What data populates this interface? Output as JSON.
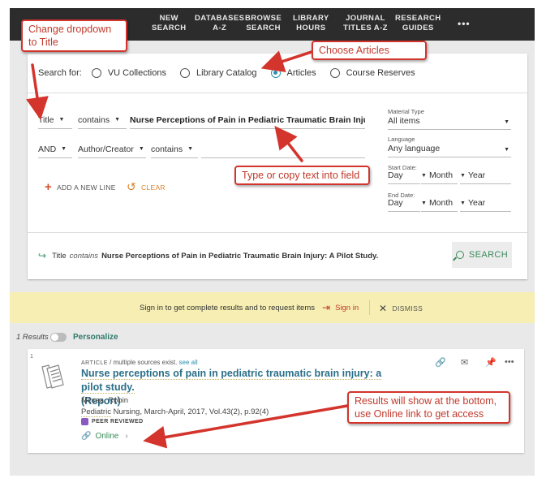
{
  "nav": {
    "items": [
      "NEW\nSEARCH",
      "DATABASES\nA-Z",
      "BROWSE\nSEARCH",
      "LIBRARY\nHOURS",
      "JOURNAL\nTITLES A-Z",
      "RESEARCH\nGUIDES"
    ],
    "more": "•••"
  },
  "search": {
    "scope_label": "Search for:",
    "scopes": [
      "VU Collections",
      "Library Catalog",
      "Articles",
      "Course Reserves"
    ],
    "selected_scope": "Articles",
    "row1": {
      "field": "Title",
      "operator": "contains",
      "query": "Nurse Perceptions of Pain in Pediatric Traumatic Brain Injury: A Pilot"
    },
    "row2": {
      "bool": "AND",
      "field": "Author/Creator",
      "operator": "contains",
      "query": ""
    },
    "material_type_label": "Material Type",
    "material_type_value": "All items",
    "language_label": "Language",
    "language_value": "Any language",
    "start_date_label": "Start Date:",
    "end_date_label": "End Date:",
    "date_day": "Day",
    "date_month": "Month",
    "date_year": "Year",
    "add_line": "ADD A NEW LINE",
    "clear": "CLEAR",
    "summary_field": "Title",
    "summary_op": "contains",
    "summary_query": "Nurse Perceptions of Pain in Pediatric Traumatic Brain Injury: A Pilot Study.",
    "button": "SEARCH"
  },
  "signin_bar": {
    "message": "Sign in to get complete results and to request items",
    "signin": "Sign in",
    "dismiss": "DISMISS"
  },
  "results": {
    "count": "1 Results",
    "personalize": "Personalize",
    "item": {
      "num": "1",
      "type": "ARTICLE",
      "type_note": "/ multiple sources exist.",
      "see_all": "see all",
      "title_line1": "Nurse perceptions of pain in pediatric traumatic brain injury: a pilot study.",
      "title_line2": "(Report)",
      "author": "Mccaa, Robin",
      "source_journal": "Pediatric",
      "source_rest": " Nursing, March-April, 2017, Vol.43(2), p.92(4)",
      "peer": "PEER REVIEWED",
      "online": "Online"
    }
  },
  "annotations": {
    "dropdown": "Change dropdown\nto Title",
    "articles": "Choose Articles",
    "type": "Type or copy text into field",
    "results": "Results will show at the bottom,\nuse Online link to get access"
  },
  "colors": {
    "accent": "#2b8fb0",
    "annotation": "#d3342c",
    "nav_bg": "#2c2c2c",
    "green": "#3a8a5a"
  }
}
